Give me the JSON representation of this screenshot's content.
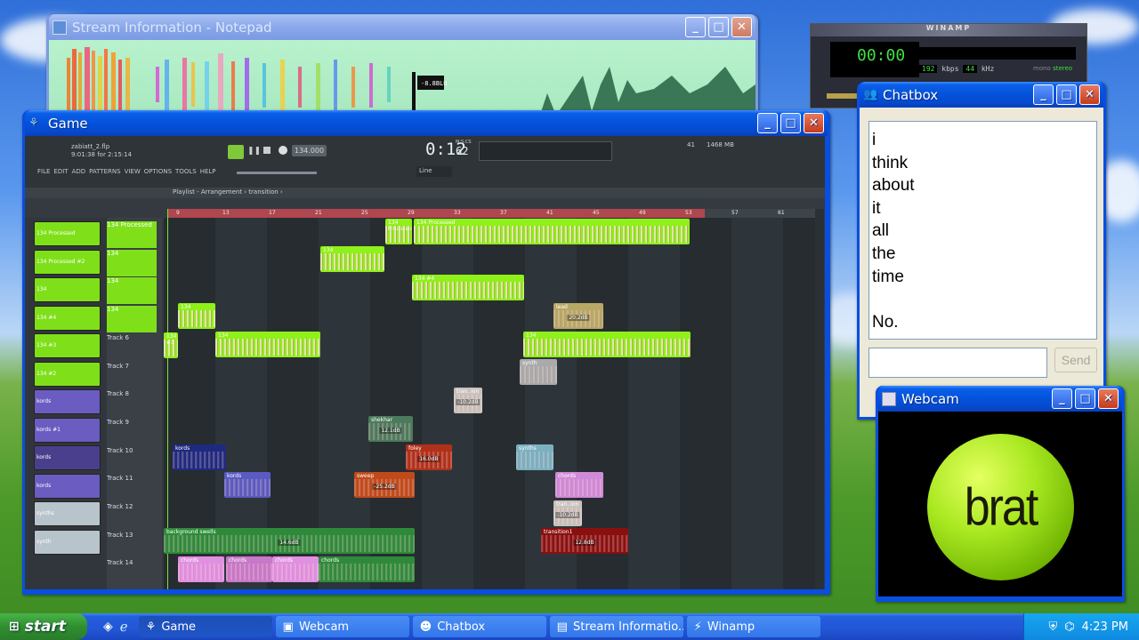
{
  "desktop": {
    "brand_accent": "#0a4ee0",
    "lime": "#8cf000"
  },
  "notepad": {
    "title": "Stream Information - Notepad",
    "meter_label": "-8.8BLU"
  },
  "winamp": {
    "title": "WINAMP",
    "time": "00:00",
    "kbps": "192",
    "kbps_unit": "kbps",
    "khz": "44",
    "khz_unit": "kHz",
    "mono": "mono",
    "stereo": "stereo"
  },
  "game": {
    "title": "Game",
    "project": {
      "file": "zabiatt_2.flp",
      "time_info": "9:01:38 for 2:15:14",
      "tempo": "134.000",
      "clock": "0:12",
      "clock_sub": "62",
      "clock_unit": "M:S:CS",
      "cpu": "41",
      "mem": "1468 MB"
    },
    "menu": [
      "FILE",
      "EDIT",
      "ADD",
      "PATTERNS",
      "VIEW",
      "OPTIONS",
      "TOOLS",
      "HELP"
    ],
    "snap": "Line",
    "breadcrumb": "Playlist - Arrangement › transition ›",
    "ruler": [
      "9",
      "13",
      "17",
      "21",
      "25",
      "29",
      "33",
      "37",
      "41",
      "45",
      "49",
      "53",
      "57",
      "61"
    ],
    "channels": [
      "134 Processed",
      "134 Processed #2",
      "134",
      "134 #4",
      "134 #3",
      "134 #2",
      "kords",
      "kords #1",
      "kords",
      "kords",
      "synths",
      "synth"
    ],
    "tracks": [
      "134 Processed",
      "134",
      "134",
      "134",
      "Track 6",
      "Track 7",
      "Track 8",
      "Track 9",
      "Track 10",
      "Track 11",
      "Track 12",
      "Track 13",
      "Track 14"
    ],
    "clips": {
      "c1": "134 #3",
      "c2": "134 Processed",
      "c3": "134 Processed",
      "c4": "134",
      "c5": "134 #4",
      "c6": "134",
      "c7": "lead",
      "c7v": "20.2dB",
      "c8": "134",
      "c9": "134",
      "c10": "synth",
      "c11": "tran..ion",
      "c11v": "-10.2dB",
      "c12": "shekhar",
      "c12v": "12.1dB",
      "c13": "foley",
      "c13v": "16.0dB",
      "c14": "kords",
      "c15": "synths",
      "c16": "kords",
      "c17": "sweep",
      "c17v": "-25.2dB",
      "c18": "chords",
      "c19": "tran..ion",
      "c19v": "-10.2dB",
      "c20": "background swells",
      "c20v": "14.6dB",
      "c21": "transition1",
      "c21v": "12.8dB",
      "c22": "chords",
      "c23": "chords",
      "c24": "chords",
      "c25": "chords"
    }
  },
  "chatbox": {
    "title": "Chatbox",
    "messages": "i\nthink\nabout\nit\nall\nthe\ntime\n\nNo.",
    "input_value": "",
    "send_label": "Send"
  },
  "webcam": {
    "title": "Webcam",
    "ball_text": "brat"
  },
  "taskbar": {
    "start_label": "start",
    "buttons": [
      "Game",
      "Webcam",
      "Chatbox",
      "Stream Informatio...",
      "Winamp"
    ],
    "clock": "4:23 PM"
  }
}
